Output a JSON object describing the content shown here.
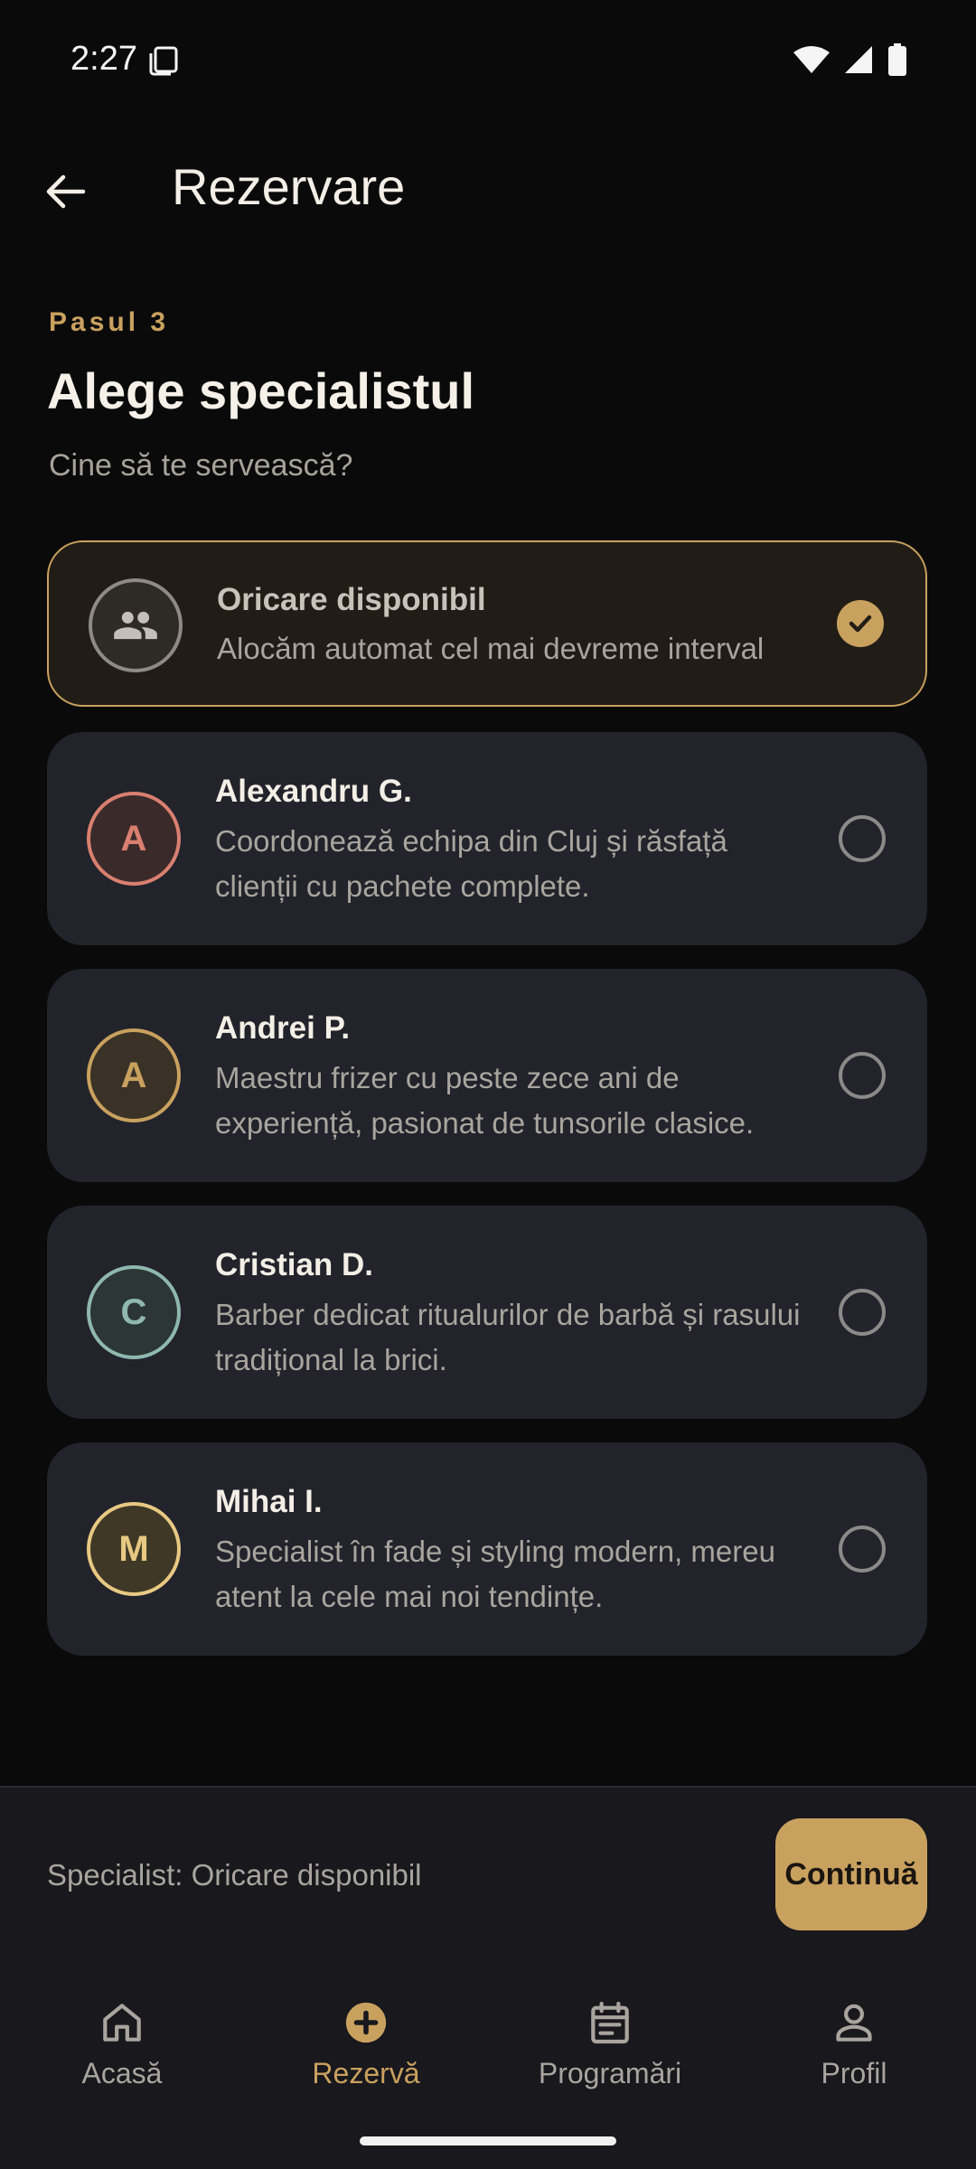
{
  "status_bar": {
    "time": "2:27"
  },
  "app_bar": {
    "title": "Rezervare"
  },
  "step": {
    "label": "Pasul 3",
    "title": "Alege specialistul",
    "subtitle": "Cine să te servească?"
  },
  "options": [
    {
      "name": "Oricare disponibil",
      "description": "Alocăm automat cel mai devreme interval",
      "initial": "",
      "icon": "group-icon",
      "selected": true
    },
    {
      "name": "Alexandru G.",
      "description": "Coordonează echipa din Cluj și răsfață clienții cu pachete complete.",
      "initial": "A",
      "color": "#d98070",
      "selected": false
    },
    {
      "name": "Andrei P.",
      "description": "Maestru frizer cu peste zece ani de experiență, pasionat de tunsorile clasice.",
      "initial": "A",
      "color": "#c9a15f",
      "selected": false
    },
    {
      "name": "Cristian D.",
      "description": "Barber dedicat ritualurilor de barbă și rasului tradițional la brici.",
      "initial": "C",
      "color": "#8fb8ae",
      "selected": false
    },
    {
      "name": "Mihai I.",
      "description": "Specialist în fade și styling modern, mereu atent la cele mai noi tendințe.",
      "initial": "M",
      "color": "#e8c983",
      "selected": false
    }
  ],
  "summary": {
    "text": "Specialist: Oricare disponibil",
    "continue_label": "Continuă"
  },
  "nav": {
    "items": [
      {
        "label": "Acasă",
        "icon": "home-icon",
        "active": false
      },
      {
        "label": "Rezervă",
        "icon": "add-circle-icon",
        "active": true
      },
      {
        "label": "Programări",
        "icon": "calendar-icon",
        "active": false
      },
      {
        "label": "Profil",
        "icon": "person-icon",
        "active": false
      }
    ]
  },
  "colors": {
    "accent": "#c9a15f",
    "background": "#0a0a0b",
    "card": "#22232b",
    "selected_card": "#211d16"
  }
}
